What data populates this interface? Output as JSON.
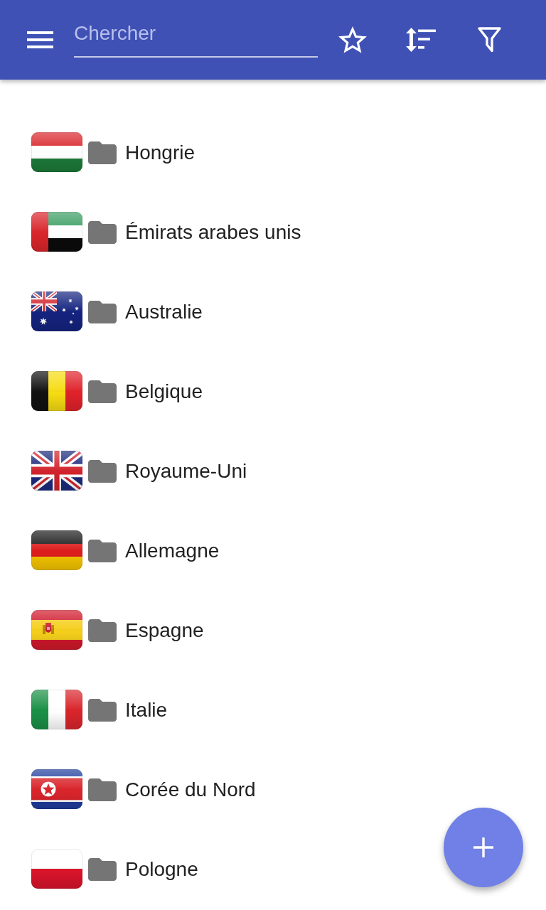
{
  "toolbar": {
    "search": {
      "placeholder": "Chercher"
    }
  },
  "folders": [
    {
      "name": "Hongrie",
      "kind": "hungary"
    },
    {
      "name": "Émirats arabes unis",
      "kind": "uae"
    },
    {
      "name": "Australie",
      "kind": "australia"
    },
    {
      "name": "Belgique",
      "kind": "belgium"
    },
    {
      "name": "Royaume-Uni",
      "kind": "uk"
    },
    {
      "name": "Allemagne",
      "kind": "germany"
    },
    {
      "name": "Espagne",
      "kind": "spain"
    },
    {
      "name": "Italie",
      "kind": "italy"
    },
    {
      "name": "Corée du Nord",
      "kind": "northkorea"
    },
    {
      "name": "Pologne",
      "kind": "poland"
    }
  ]
}
